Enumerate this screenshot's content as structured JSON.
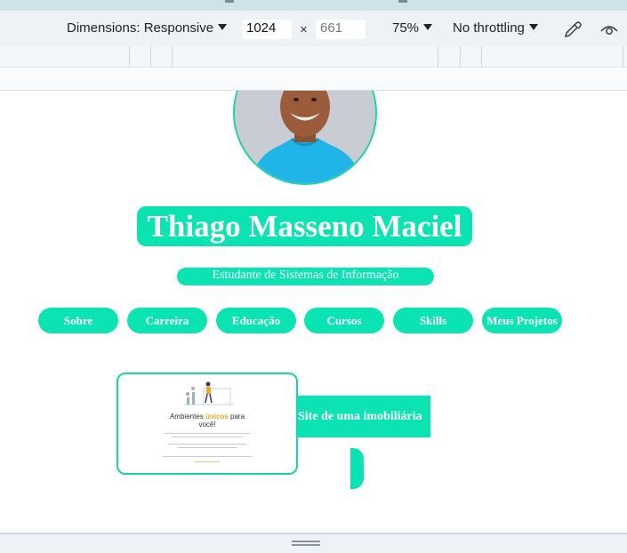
{
  "toolbar": {
    "dimensions_label": "Dimensions: Responsive",
    "width_value": "1024",
    "times": "×",
    "height_placeholder": "661",
    "zoom": "75%",
    "throttling": "No throttling",
    "icons": [
      "caret-down-icon",
      "eyedropper-icon",
      "eye-icon"
    ]
  },
  "profile": {
    "name": "Thiago Masseno Maciel",
    "subtitle": "Estudante de Sistemas de Informação"
  },
  "nav": {
    "items": [
      "Sobre",
      "Carreira",
      "Educação",
      "Cursos",
      "Skills",
      "Meus Projetos"
    ]
  },
  "project": {
    "thumbnail": {
      "title_prefix": "Ambientes",
      "title_accent": "únicos",
      "title_suffix": "para",
      "title_line2": "você!"
    },
    "label": "Site de uma imobiliária"
  },
  "colors": {
    "accent": "#0be4b2",
    "accent_border": "#1ad4a6",
    "toolbar_bg": "#edf2f7",
    "thumbnail_accent": "#f5a623"
  }
}
